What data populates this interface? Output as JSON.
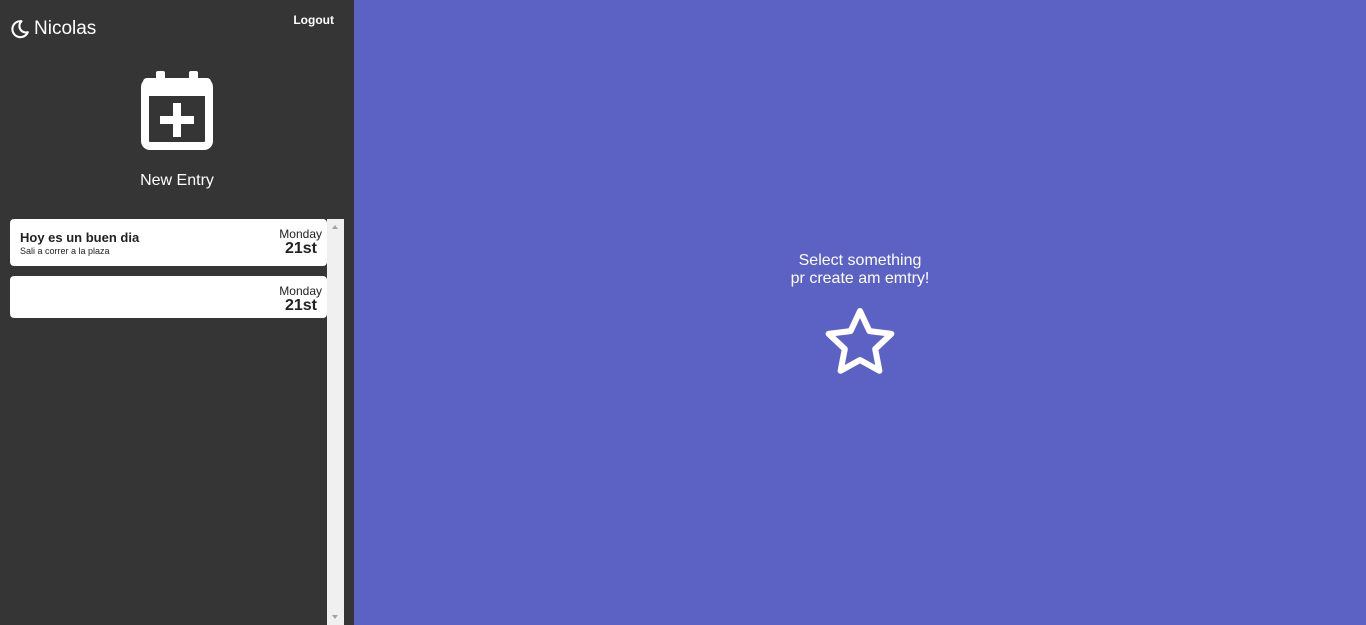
{
  "header": {
    "user_name": "Nicolas",
    "user_icon": "moon-icon",
    "logout_label": "Logout"
  },
  "new_entry": {
    "label": "New Entry",
    "icon": "calendar-plus-icon"
  },
  "entries": [
    {
      "title": "Hoy es un buen dia",
      "body": "Sali a correr a la plaza",
      "day": "Monday",
      "date": "21st"
    },
    {
      "title": "",
      "body": "",
      "day": "Monday",
      "date": "21st"
    }
  ],
  "main": {
    "prompt_line1": "Select something",
    "prompt_line2": "pr create am emtry!",
    "icon": "star-icon"
  },
  "colors": {
    "sidebar_bg": "#353535",
    "main_bg": "#5c62c4",
    "card_bg": "#ffffff"
  }
}
